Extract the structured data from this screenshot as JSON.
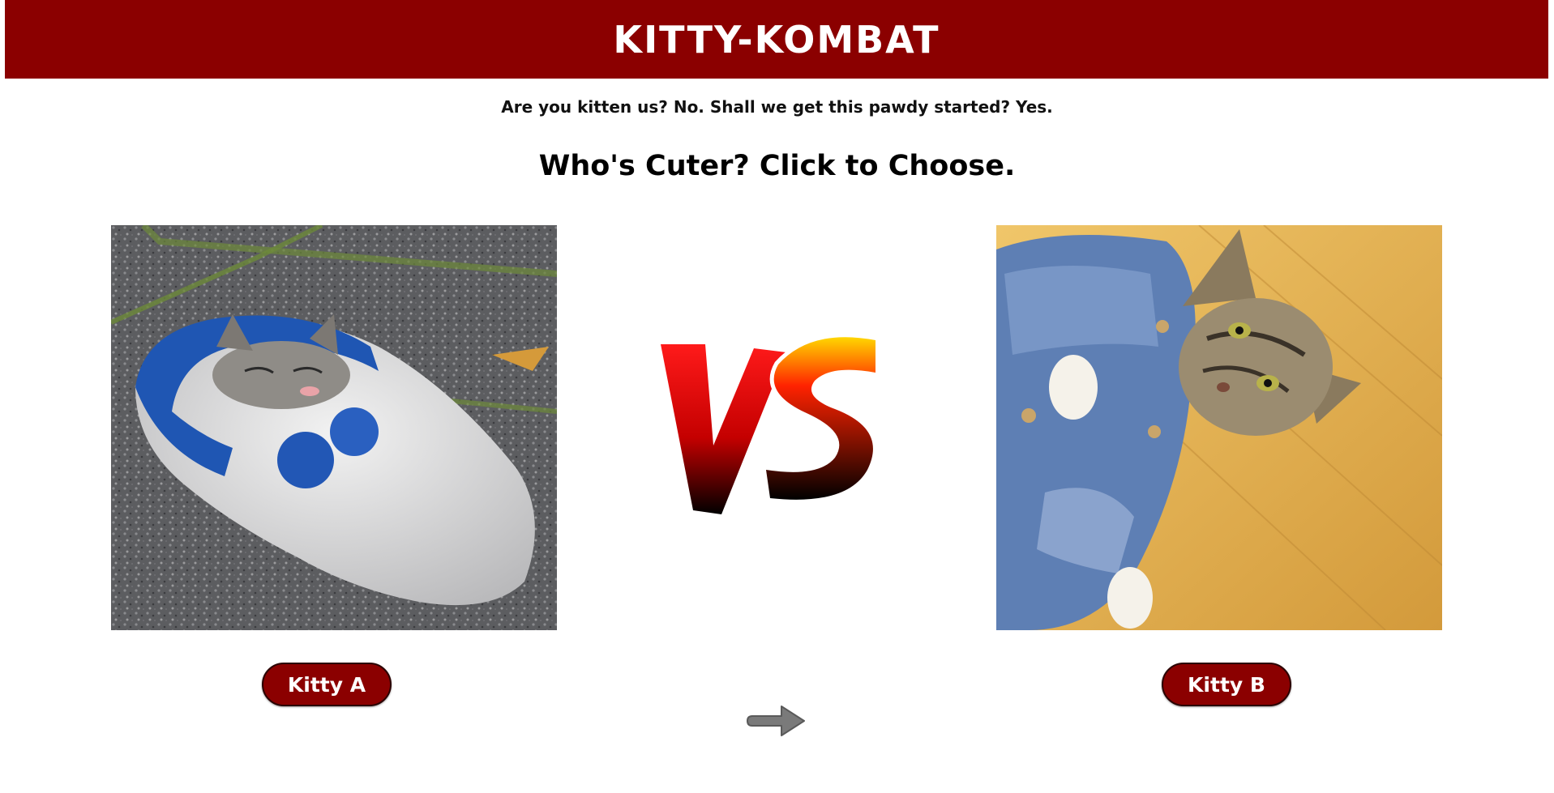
{
  "header": {
    "title": "KITTY-KOMBAT",
    "background_color": "#8b0000"
  },
  "tagline": "Are you kitten us? No. Shall we get this pawdy started? Yes.",
  "prompt": "Who's Cuter? Click to Choose.",
  "contenders": [
    {
      "id": "a",
      "button_label": "Kitty A",
      "image_description": "kitten sleeping in a blue and white felt slipper"
    },
    {
      "id": "b",
      "button_label": "Kitty B",
      "image_description": "tabby cat wearing a denim jacket lying on a wooden floor"
    }
  ],
  "vs_logo": {
    "text": "VS",
    "colors": [
      "#ff0000",
      "#000000",
      "#ffd700"
    ]
  },
  "next_icon": "right-arrow-icon",
  "accent_color": "#8b0000"
}
